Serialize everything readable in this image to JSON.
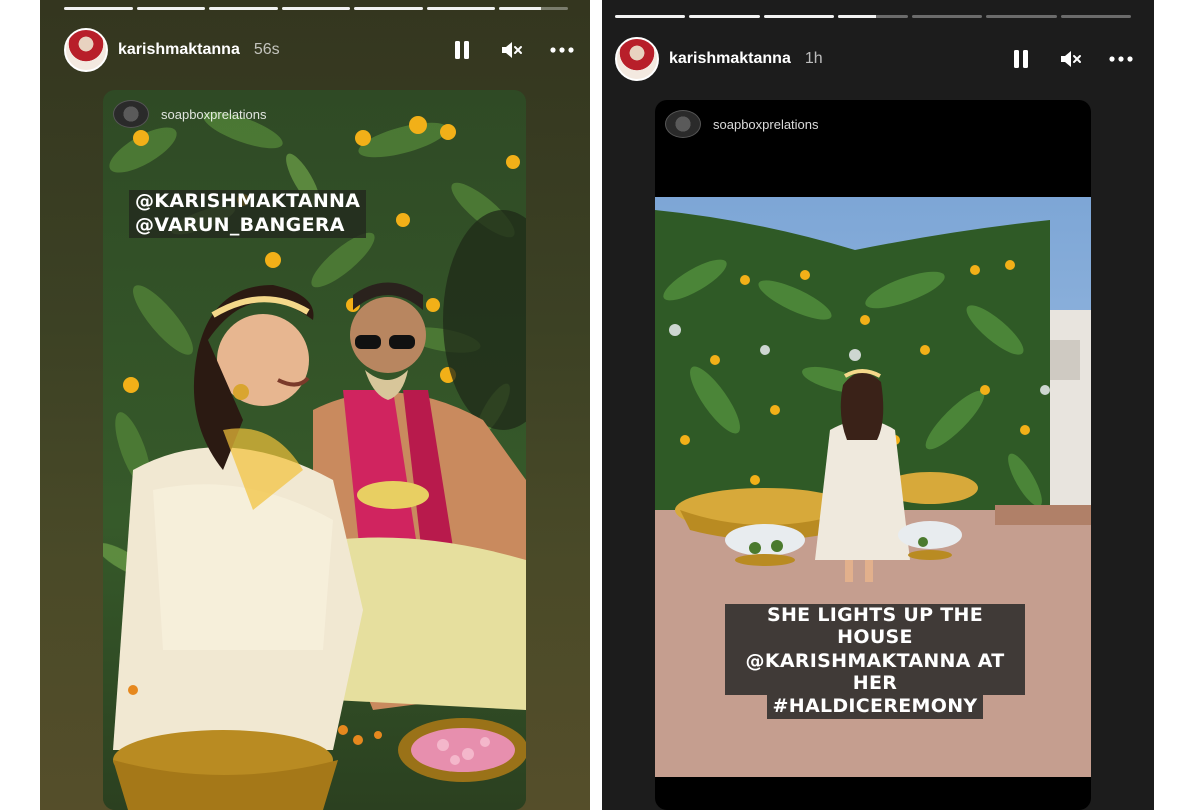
{
  "stories": [
    {
      "username": "karishmaktanna",
      "time_ago": "56s",
      "progress_segments": [
        1,
        1,
        1,
        1,
        1,
        1,
        0.6
      ],
      "embedded_username": "soapboxprelations",
      "tags": [
        "@KARISHMAKTANNA",
        "@VARUN_BANGERA"
      ],
      "icons": {
        "pause": "pause-icon",
        "mute": "speaker-muted-icon",
        "more": "more-horizontal-icon"
      }
    },
    {
      "username": "karishmaktanna",
      "time_ago": "1h",
      "progress_segments": [
        1,
        1,
        1,
        0.55,
        0,
        0,
        0
      ],
      "embedded_username": "soapboxprelations",
      "caption_lines": [
        "SHE LIGHTS UP THE HOUSE",
        "@KARISHMAKTANNA AT HER",
        "#HALDICEREMONY"
      ],
      "icons": {
        "pause": "pause-icon",
        "mute": "speaker-muted-icon",
        "more": "more-horizontal-icon"
      }
    }
  ]
}
